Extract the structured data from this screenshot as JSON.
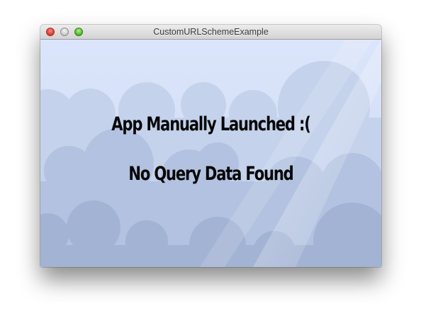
{
  "window": {
    "title": "CustomURLSchemeExample"
  },
  "titlebar_buttons": [
    "close",
    "minimize",
    "zoom"
  ],
  "messages": {
    "launch_status": "App Manually Launched :(",
    "query_status": "No Query Data Found"
  },
  "colors": {
    "sky_top": "#dde7fb",
    "cloud_back": "#bccbe6",
    "cloud_mid": "#aebedd",
    "cloud_front": "#9fb1d3",
    "text": "#050505"
  }
}
